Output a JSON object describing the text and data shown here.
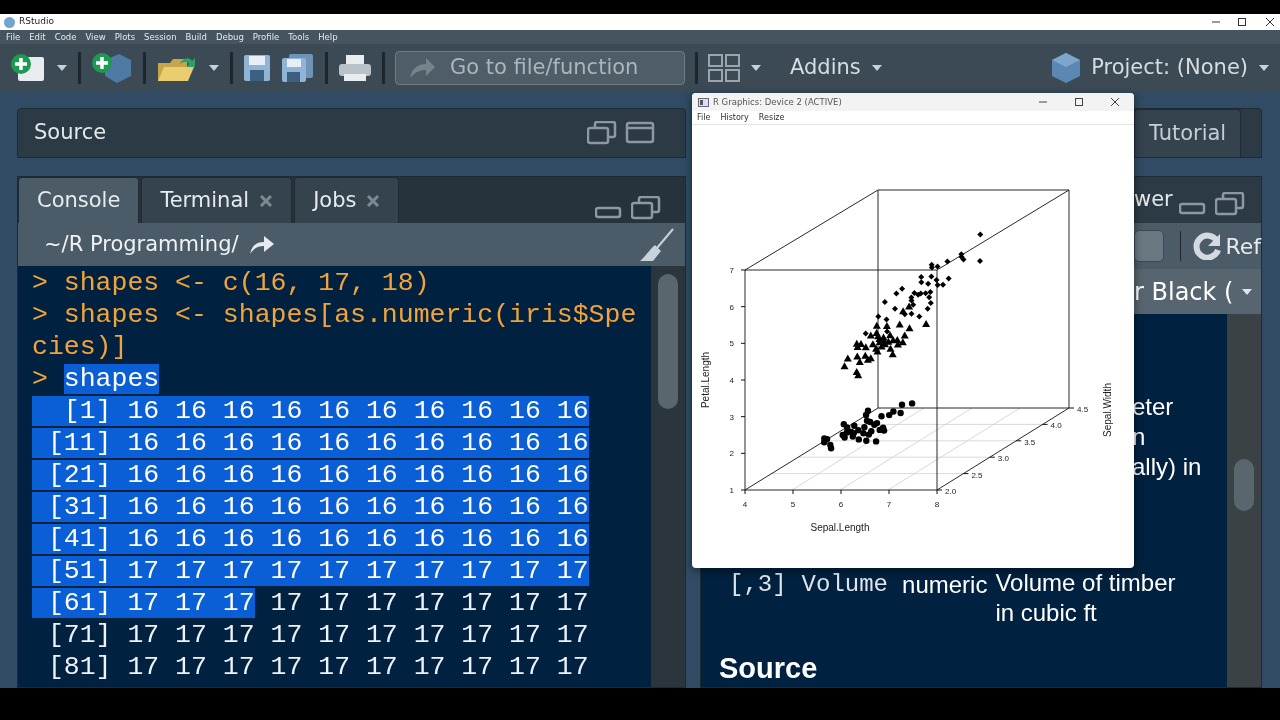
{
  "window": {
    "title": "RStudio"
  },
  "menu": [
    "File",
    "Edit",
    "Code",
    "View",
    "Plots",
    "Session",
    "Build",
    "Debug",
    "Profile",
    "Tools",
    "Help"
  ],
  "toolbar": {
    "goto_placeholder": "Go to file/function",
    "addins": "Addins",
    "project": "Project: (None)"
  },
  "source_pane": {
    "title": "Source"
  },
  "console_pane": {
    "tabs": [
      {
        "label": "Console",
        "selected": true,
        "closable": false
      },
      {
        "label": "Terminal",
        "selected": false,
        "closable": true
      },
      {
        "label": "Jobs",
        "selected": false,
        "closable": true
      }
    ],
    "path": "~/R Programming/",
    "lines": [
      {
        "kind": "input",
        "segments": [
          {
            "text": "> shapes <- c(16, 17, 18)",
            "selected": false
          }
        ]
      },
      {
        "kind": "input",
        "segments": [
          {
            "text": "> shapes <- shapes[as.numeric(iris$Spe",
            "selected": false
          }
        ]
      },
      {
        "kind": "input",
        "segments": [
          {
            "text": "cies)]",
            "selected": false
          }
        ]
      },
      {
        "kind": "input",
        "segments": [
          {
            "text": "> ",
            "selected": false
          },
          {
            "text": "shapes",
            "selected": true
          }
        ]
      },
      {
        "kind": "output",
        "segments": [
          {
            "text": "  [1] 16 16 16 16 16 16 16 16 16 16",
            "selected": true
          }
        ]
      },
      {
        "kind": "output",
        "segments": [
          {
            "text": " [11] 16 16 16 16 16 16 16 16 16 16",
            "selected": true
          }
        ]
      },
      {
        "kind": "output",
        "segments": [
          {
            "text": " [21] 16 16 16 16 16 16 16 16 16 16",
            "selected": true
          }
        ]
      },
      {
        "kind": "output",
        "segments": [
          {
            "text": " [31] 16 16 16 16 16 16 16 16 16 16",
            "selected": true
          }
        ]
      },
      {
        "kind": "output",
        "segments": [
          {
            "text": " [41] 16 16 16 16 16 16 16 16 16 16",
            "selected": true
          }
        ]
      },
      {
        "kind": "output",
        "segments": [
          {
            "text": " [51] 17 17 17 17 17 17 17 17 17 17",
            "selected": true
          }
        ]
      },
      {
        "kind": "output",
        "segments": [
          {
            "text": " [61] 17 17 17",
            "selected": true
          },
          {
            "text": " 17 17 17 17 17 17 17",
            "selected": false
          }
        ]
      },
      {
        "kind": "output",
        "segments": [
          {
            "text": " [71] 17 17 17 17 17 17 17 17 17 17",
            "selected": false
          }
        ]
      },
      {
        "kind": "output",
        "segments": [
          {
            "text": " [81] 17 17 17 17 17 17 17 17 17 17",
            "selected": false
          }
        ]
      }
    ]
  },
  "right_panes": {
    "tabs": [
      {
        "label": "Tutorial",
        "selected": false
      }
    ],
    "viewer_title": "wer",
    "refresh_label": "Ref",
    "dropdown": "r Black (",
    "help_fragments": [
      "eter",
      "n",
      "ally) in"
    ],
    "args_row": {
      "index": "[,3]",
      "name": "Volume",
      "type": "numeric",
      "description": "Volume of timber in cubic ft"
    },
    "heading": "Source"
  },
  "graphics_window": {
    "title": "R Graphics: Device 2 (ACTIVE)",
    "menu": [
      "File",
      "History",
      "Resize"
    ],
    "plot": {
      "xlabel": "Sepal.Length",
      "ylabel": "Petal.Length",
      "zlabel": "Sepal.Width",
      "xticks": [
        "4",
        "5",
        "6",
        "7",
        "8"
      ],
      "yticks": [
        "7",
        "6",
        "5",
        "4",
        "3",
        "2",
        "1"
      ],
      "zticks": [
        "2.0",
        "2.5",
        "3.0",
        "3.5",
        "4.0",
        "4.5"
      ]
    }
  }
}
